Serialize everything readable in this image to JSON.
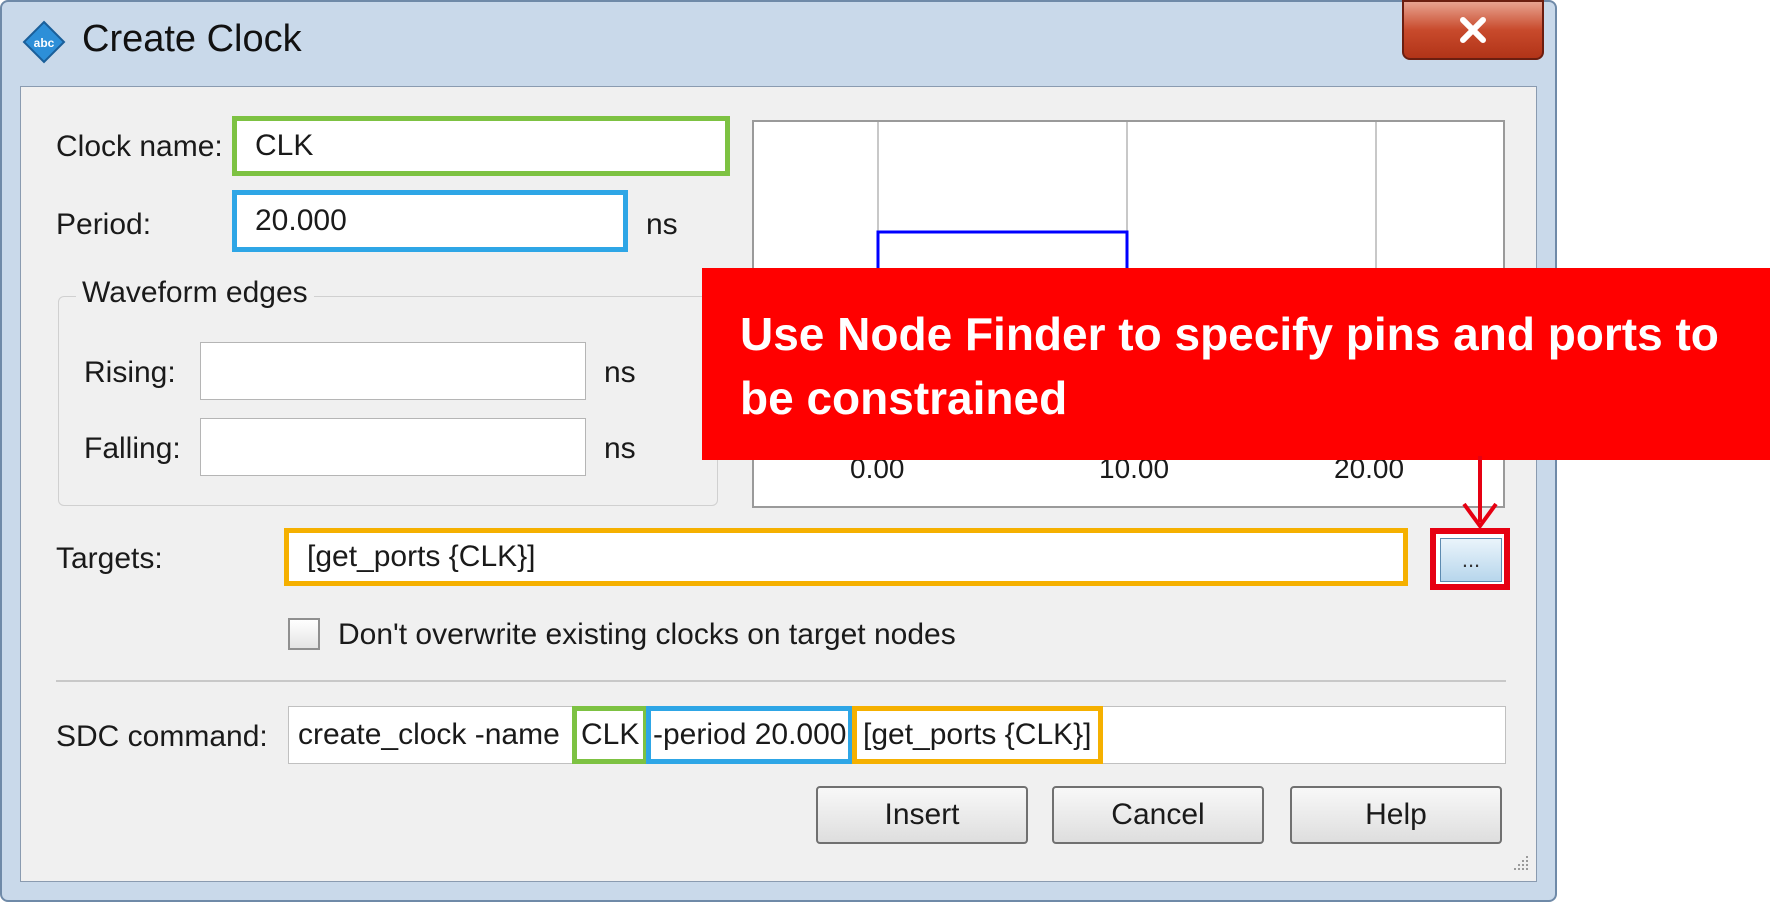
{
  "window": {
    "title": "Create Clock",
    "close_glyph": "X",
    "app_icon": "abc-icon"
  },
  "form": {
    "clock_name_label": "Clock name:",
    "clock_name_value": "CLK",
    "period_label": "Period:",
    "period_value": "20.000",
    "period_unit": "ns",
    "waveform_group_title": "Waveform edges",
    "rising_label": "Rising:",
    "rising_value": "",
    "rising_unit": "ns",
    "falling_label": "Falling:",
    "falling_value": "",
    "falling_unit": "ns",
    "targets_label": "Targets:",
    "targets_value": "[get_ports {CLK}]",
    "node_finder_button_label": "...",
    "dont_overwrite_label": "Don't overwrite existing clocks on target nodes",
    "dont_overwrite_checked": false,
    "sdc_label": "SDC command:",
    "sdc_parts": {
      "prefix": "create_clock -name",
      "name": "CLK",
      "period": "-period 20.000",
      "targets": "[get_ports {CLK}]"
    }
  },
  "waveform": {
    "tick_labels": [
      "0.00",
      "10.00",
      "20.00"
    ],
    "rise_at": 0.0,
    "fall_at": 10.0,
    "period": 20.0
  },
  "buttons": {
    "insert": "Insert",
    "cancel": "Cancel",
    "help": "Help"
  },
  "callout": {
    "text": "Use Node Finder to specify pins and ports to be constrained"
  },
  "colors": {
    "clock_name_highlight": "#7dc242",
    "period_highlight": "#2ea6e6",
    "targets_highlight": "#f5b000",
    "callout": "#ff0000",
    "waveform_line": "#0000ff"
  }
}
